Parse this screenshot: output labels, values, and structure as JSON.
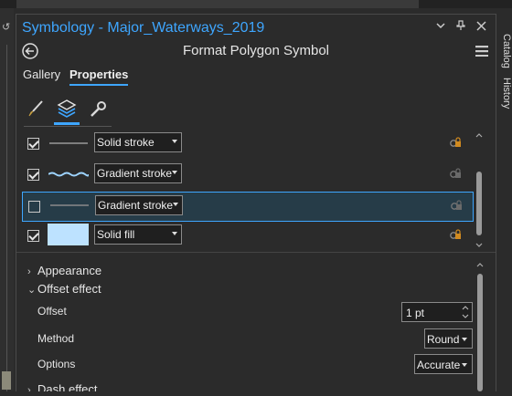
{
  "window": {
    "title": "Symbology - Major_Waterways_2019",
    "subtitle": "Format Polygon Symbol"
  },
  "tabs": [
    {
      "label": "Gallery",
      "active": false
    },
    {
      "label": "Properties",
      "active": true
    }
  ],
  "symbol_tools": [
    "paintbrush-icon",
    "layers-icon",
    "wrench-icon"
  ],
  "symbol_tools_selected": 1,
  "layers": [
    {
      "checked": true,
      "preview": "solid-line",
      "type": "Solid stroke",
      "selected": false
    },
    {
      "checked": true,
      "preview": "wavy-line",
      "type": "Gradient stroke",
      "selected": false
    },
    {
      "checked": false,
      "preview": "solid-line",
      "type": "Gradient stroke",
      "selected": true
    },
    {
      "checked": true,
      "preview": "fill-swatch",
      "type": "Solid fill",
      "selected": false
    }
  ],
  "sections": {
    "appearance": "Appearance",
    "offset_effect": "Offset effect",
    "dash_effect": "Dash effect"
  },
  "offset_effect": {
    "offset_label": "Offset",
    "offset_value": "1 pt",
    "method_label": "Method",
    "method_value": "Round",
    "options_label": "Options",
    "options_value": "Accurate"
  },
  "side_tabs": [
    "Catalog",
    "History"
  ],
  "colors": {
    "accent": "#3ea6ff",
    "fill_swatch": "#bde2ff",
    "selected_row": "#263c48"
  }
}
